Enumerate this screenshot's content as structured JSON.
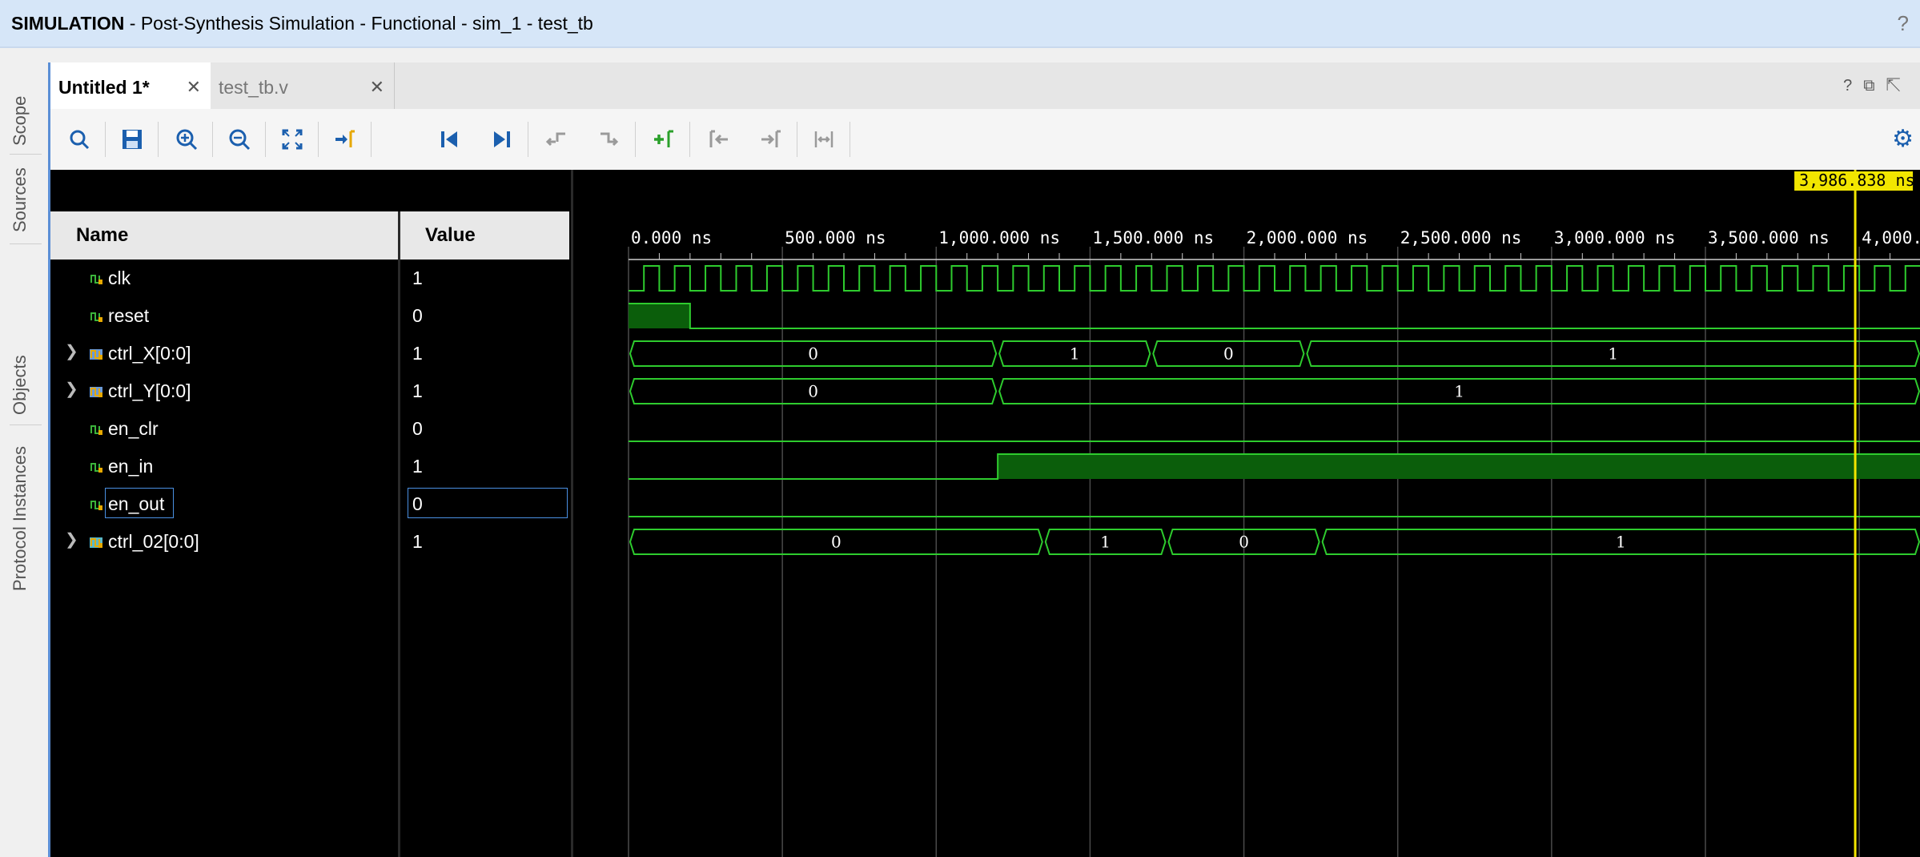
{
  "titlebar": {
    "mode": "SIMULATION",
    "context": " - Post-Synthesis Simulation - Functional - sim_1 - test_tb",
    "help": "?"
  },
  "sidebar": {
    "tabs": [
      "Scope",
      "Sources",
      "Objects",
      "Protocol Instances"
    ]
  },
  "tabs": [
    {
      "label": "Untitled 1*",
      "active": true
    },
    {
      "label": "test_tb.v",
      "active": false
    }
  ],
  "toolbar": {
    "buttons": [
      "search",
      "save",
      "zoom-in",
      "zoom-out",
      "zoom-fit",
      "go-to-cursor",
      "go-to-time-0",
      "go-to-last-time",
      "previous-transition",
      "next-transition",
      "add-marker",
      "previous-marker",
      "next-marker",
      "swap-cursors"
    ],
    "settings": "gear"
  },
  "columns": {
    "name": "Name",
    "value": "Value"
  },
  "cursor": {
    "time_ns": 3986.838,
    "label": "3,986.838 ns",
    "color": "#f2e600"
  },
  "timeline": {
    "unit": "ns",
    "ticks": [
      "0.000 ns",
      "500.000 ns",
      "1,000.000 ns",
      "1,500.000 ns",
      "2,000.000 ns",
      "2,500.000 ns",
      "3,000.000 ns",
      "3,500.000 ns",
      "4,000.0"
    ],
    "tick_values_ns": [
      0,
      500,
      1000,
      1500,
      2000,
      2500,
      3000,
      3500,
      4000
    ],
    "visible_range_ns": [
      0,
      4200
    ]
  },
  "wave_color": "#2ecc2e",
  "signals": [
    {
      "name": "clk",
      "value": "1",
      "bus": false,
      "icon": "logic-icon",
      "kind": "clock",
      "period_ns": 100,
      "high_first_ns": 50
    },
    {
      "name": "reset",
      "value": "0",
      "bus": false,
      "icon": "logic-icon",
      "kind": "bit",
      "transitions": [
        [
          0,
          1
        ],
        [
          200,
          0
        ]
      ]
    },
    {
      "name": "ctrl_X[0:0]",
      "value": "1",
      "bus": true,
      "icon": "bus-icon",
      "kind": "bus",
      "segments": [
        [
          0,
          1200,
          "0"
        ],
        [
          1200,
          1700,
          "1"
        ],
        [
          1700,
          2200,
          "0"
        ],
        [
          2200,
          4200,
          "1"
        ]
      ]
    },
    {
      "name": "ctrl_Y[0:0]",
      "value": "1",
      "bus": true,
      "icon": "bus-icon",
      "kind": "bus",
      "segments": [
        [
          0,
          1200,
          "0"
        ],
        [
          1200,
          4200,
          "1"
        ]
      ]
    },
    {
      "name": "en_clr",
      "value": "0",
      "bus": false,
      "icon": "logic-icon",
      "kind": "bit",
      "transitions": [
        [
          0,
          0
        ]
      ]
    },
    {
      "name": "en_in",
      "value": "1",
      "bus": false,
      "icon": "logic-icon",
      "kind": "bit",
      "transitions": [
        [
          0,
          0
        ],
        [
          1200,
          1
        ]
      ]
    },
    {
      "name": "en_out",
      "value": "0",
      "bus": false,
      "icon": "logic-icon",
      "kind": "bit",
      "transitions": [
        [
          0,
          0
        ]
      ],
      "selected": true
    },
    {
      "name": "ctrl_02[0:0]",
      "value": "1",
      "bus": true,
      "icon": "bus-alt-icon",
      "kind": "bus",
      "segments": [
        [
          0,
          1350,
          "0"
        ],
        [
          1350,
          1750,
          "1"
        ],
        [
          1750,
          2250,
          "0"
        ],
        [
          2250,
          4200,
          "1"
        ]
      ]
    }
  ]
}
